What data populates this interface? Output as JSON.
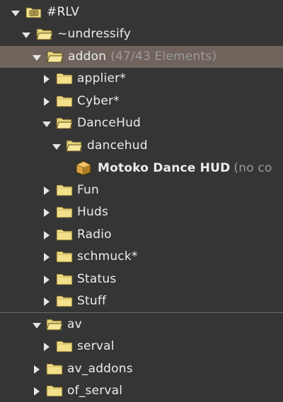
{
  "colors": {
    "background": "#353535",
    "selected_row": "#6f635c",
    "folder_fill": "#f3e08a",
    "text": "#ececec",
    "muted_text": "#9a9a9a"
  },
  "tree": {
    "rlv": {
      "label": "#RLV",
      "icon": "folder-open-icon"
    },
    "undressify": {
      "label": "~undressify",
      "icon": "folder-open-icon"
    },
    "addon": {
      "label": "addon",
      "suffix": "(47/43 Elements)",
      "icon": "folder-open-icon"
    },
    "applier": {
      "label": "applier*",
      "icon": "folder-icon"
    },
    "cyber": {
      "label": "Cyber*",
      "icon": "folder-icon"
    },
    "dancehud_parent": {
      "label": "DanceHud",
      "icon": "folder-open-icon"
    },
    "dancehud_child": {
      "label": "dancehud",
      "icon": "folder-open-icon"
    },
    "motoko": {
      "label": "Motoko Dance HUD",
      "suffix": "(no co",
      "icon": "object-box-icon"
    },
    "fun": {
      "label": "Fun",
      "icon": "folder-icon"
    },
    "huds": {
      "label": "Huds",
      "icon": "folder-icon"
    },
    "radio": {
      "label": "Radio",
      "icon": "folder-icon"
    },
    "schmuck": {
      "label": "schmuck*",
      "icon": "folder-icon"
    },
    "status": {
      "label": "Status",
      "icon": "folder-icon"
    },
    "stuff": {
      "label": "Stuff",
      "icon": "folder-icon"
    },
    "av": {
      "label": "av",
      "icon": "folder-open-icon"
    },
    "serval": {
      "label": "serval",
      "icon": "folder-icon"
    },
    "av_addons": {
      "label": "av_addons",
      "icon": "folder-icon"
    },
    "of_serval": {
      "label": "of_serval",
      "icon": "folder-icon"
    }
  }
}
